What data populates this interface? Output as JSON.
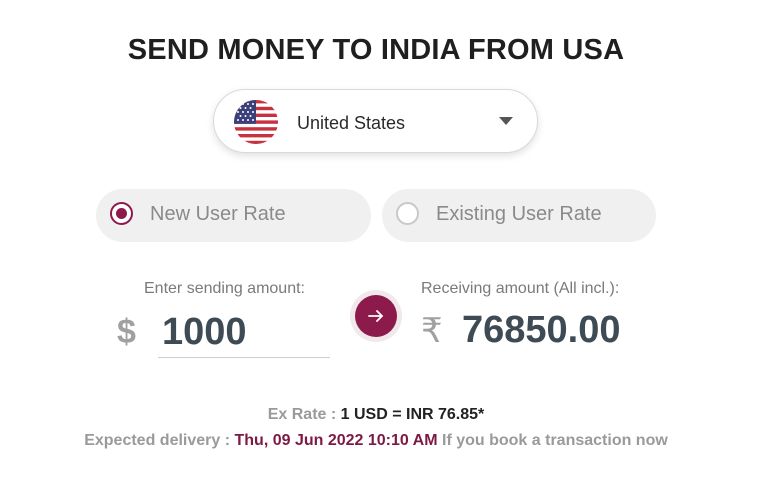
{
  "title": "SEND MONEY TO INDIA FROM USA",
  "country_select": {
    "selected": "United States",
    "flag_icon": "us-flag-icon",
    "caret_icon": "chevron-down-icon"
  },
  "rate_options": {
    "new_user": {
      "label": "New User Rate",
      "selected": true
    },
    "existing_user": {
      "label": "Existing User Rate",
      "selected": false
    }
  },
  "send": {
    "label": "Enter sending amount:",
    "currency_symbol": "$",
    "amount": "1000"
  },
  "receive": {
    "label": "Receiving amount (All incl.):",
    "currency_symbol": "₹",
    "amount": "76850.00"
  },
  "convert_icon": "arrow-right-icon",
  "ex_rate": {
    "label": "Ex Rate :",
    "value": "1 USD = INR 76.85*"
  },
  "delivery": {
    "label": "Expected delivery :",
    "date": "Thu, 09 Jun 2022 10:10 AM",
    "suffix": "If you book a transaction now"
  },
  "colors": {
    "accent": "#8c1a4a",
    "amount_text": "#3e4a54",
    "pill_bg": "#f0f0f0"
  }
}
